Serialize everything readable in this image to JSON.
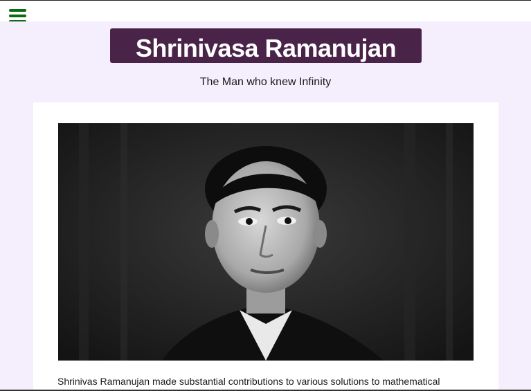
{
  "nav": {
    "menu_icon": "hamburger-menu-icon",
    "menu_color": "#0b6b12"
  },
  "header": {
    "title": "Shrinivasa Ramanujan",
    "title_bg": "#4a2349",
    "subtitle": "The Man who knew Infinity"
  },
  "main": {
    "portrait_alt": "portrait",
    "bio_text": "Shrinivas Ramanujan made substantial contributions to various solutions to mathematical"
  },
  "colors": {
    "page_bg": "#f5eefc",
    "card_bg": "#ffffff"
  }
}
